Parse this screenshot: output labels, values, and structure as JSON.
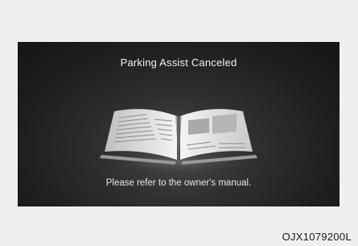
{
  "screen": {
    "title": "Parking Assist Canceled",
    "message": "Please refer to the owner's manual.",
    "illustration": "open-book-icon"
  },
  "figure": {
    "code": "OJX1079200L"
  },
  "colors": {
    "page_background": "#efefef",
    "screen_background": "#1e1e1e",
    "screen_text": "#f2f2f2"
  }
}
